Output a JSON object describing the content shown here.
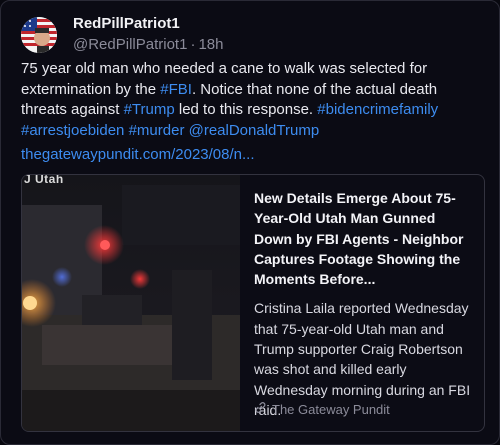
{
  "post": {
    "author": {
      "display_name": "RedPillPatriot1",
      "handle": "@RedPillPatriot1",
      "separator": "·",
      "timestamp": "18h",
      "avatar_icon": "avatar-flag-icon"
    },
    "text_segments": [
      {
        "text": "75 year old man who needed a cane to walk was selected for extermination by the ",
        "link": false
      },
      {
        "text": "#FBI",
        "link": true
      },
      {
        "text": ". Notice that none of the actual death threats against ",
        "link": false
      },
      {
        "text": "#Trump",
        "link": true
      },
      {
        "text": " led to this response. ",
        "link": false
      },
      {
        "text": "#bidencrimefamily",
        "link": true
      },
      {
        "text": " ",
        "link": false
      },
      {
        "text": "#arrestjoebiden",
        "link": true
      },
      {
        "text": " ",
        "link": false
      },
      {
        "text": "#murder",
        "link": true
      },
      {
        "text": " ",
        "link": false
      },
      {
        "text": "@realDonaldTrump",
        "link": true
      }
    ],
    "url_text": "thegatewaypundit.com/2023/08/n...",
    "card": {
      "image_caption": "J Utah",
      "title": "New Details Emerge About 75-Year-Old Utah Man Gunned Down by FBI Agents - Neighbor Captures Footage Showing the Moments Before...",
      "description": "Cristina Laila reported Wednesday that 75-year-old Utah man and Trump supporter Craig Robertson was shot and killed early Wednesday morning during an FBI raid.",
      "source": "The Gateway Pundit",
      "source_icon": "link-icon"
    }
  },
  "colors": {
    "background": "#0b0b14",
    "link": "#3d8cf0",
    "muted": "#8b8b99",
    "border": "#33333f"
  }
}
